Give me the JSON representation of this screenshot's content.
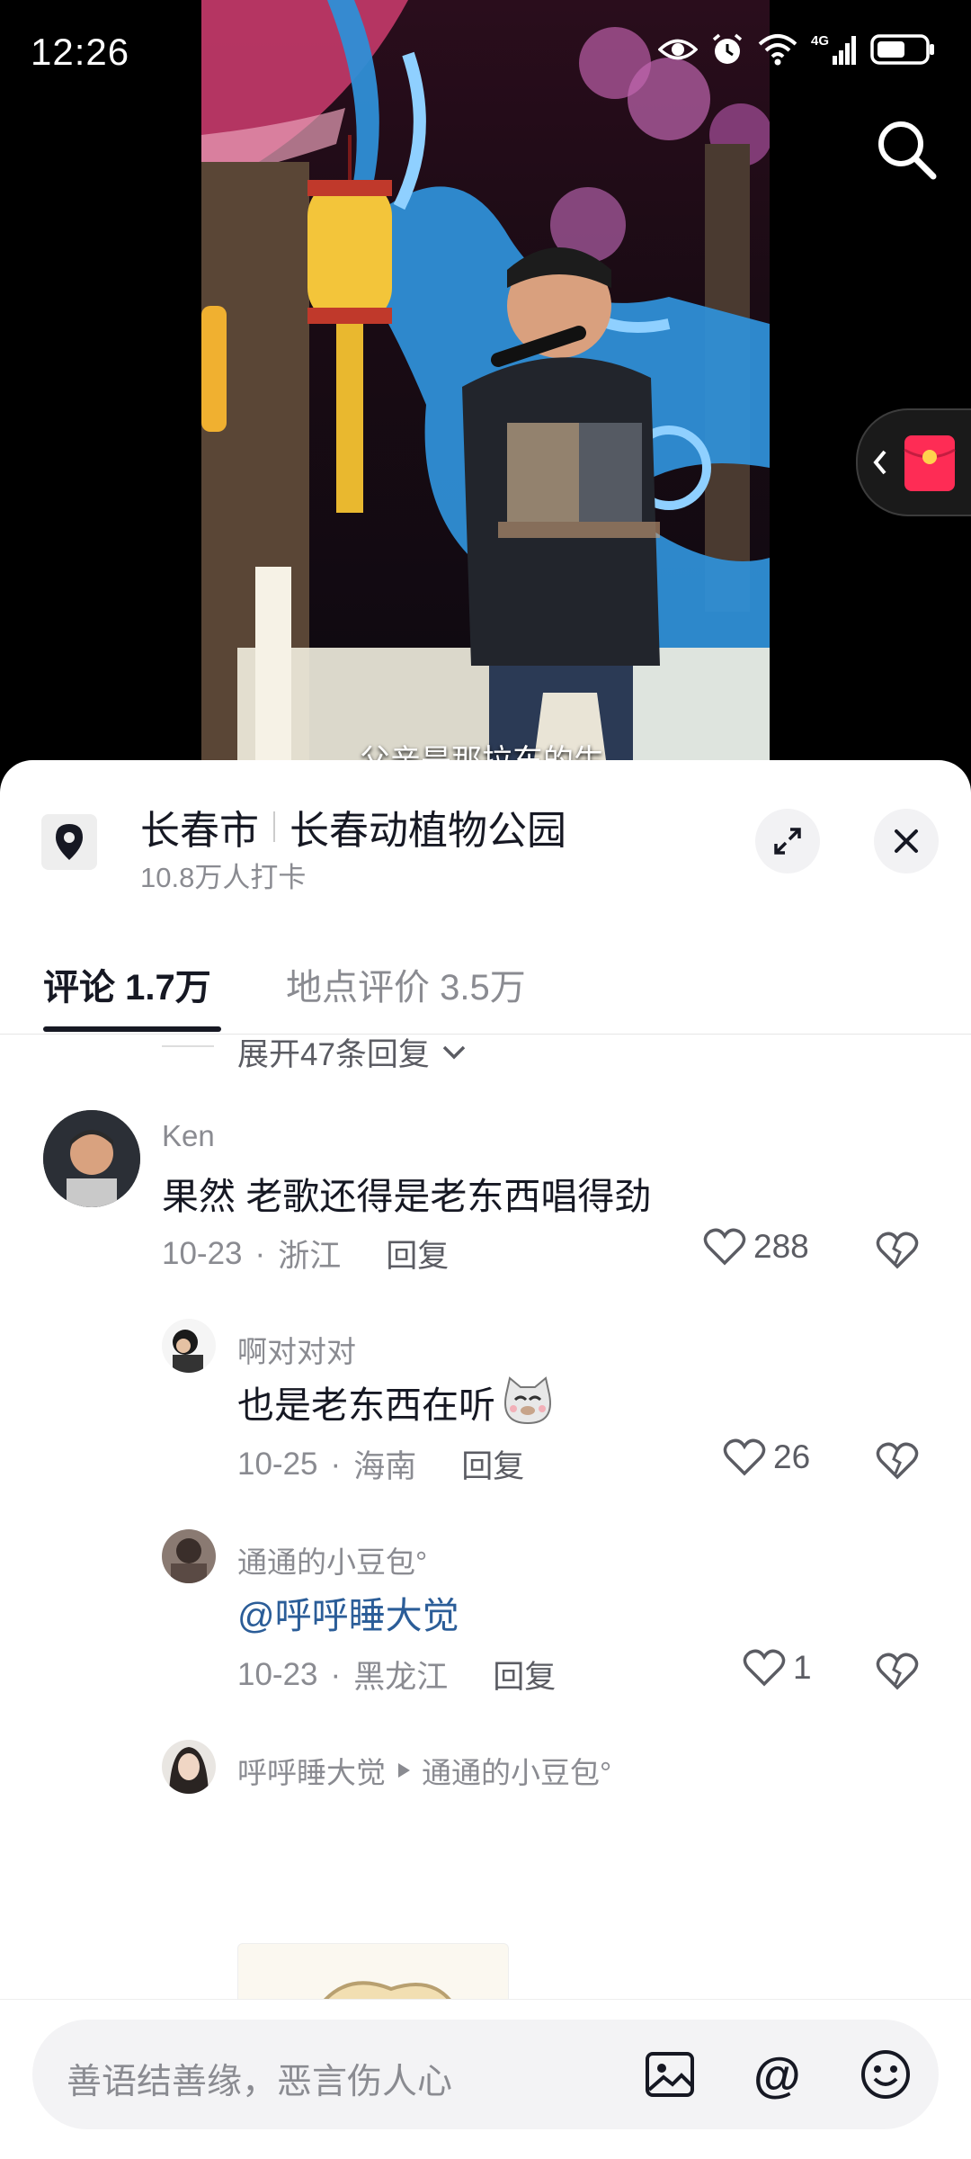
{
  "status_bar": {
    "time": "12:26",
    "network": "4G"
  },
  "video": {
    "subtitle": "父亲是那拉东的生"
  },
  "location": {
    "city": "长春市",
    "place": "长春动植物公园",
    "checkins": "10.8万人打卡"
  },
  "tabs": [
    {
      "label": "评论 1.7万",
      "active": true
    },
    {
      "label": "地点评价 3.5万",
      "active": false
    }
  ],
  "expand_replies": "展开47条回复",
  "comments": [
    {
      "user": "Ken",
      "text": "果然  老歌还得是老东西唱得劲",
      "date": "10-23",
      "region": "浙江",
      "reply": "回复",
      "likes": "288"
    },
    {
      "user": "啊对对对",
      "text": "也是老东西在听",
      "emoji": "cat-emoji",
      "date": "10-25",
      "region": "海南",
      "reply": "回复",
      "likes": "26"
    },
    {
      "user": "通通的小豆包°",
      "text": "@呼呼睡大觉",
      "date": "10-23",
      "region": "黑龙江",
      "reply": "回复",
      "likes": "1"
    },
    {
      "user": "呼呼睡大觉",
      "reply_to": "通通的小豆包°",
      "image": "cartoon-sheep-sticker"
    }
  ],
  "input": {
    "placeholder": "善语结善缘，恶言伤人心"
  },
  "colors": {
    "mention": "#2b5d98",
    "text": "#161823",
    "muted": "#8a8b91",
    "redpacket": "#fe2c55"
  }
}
